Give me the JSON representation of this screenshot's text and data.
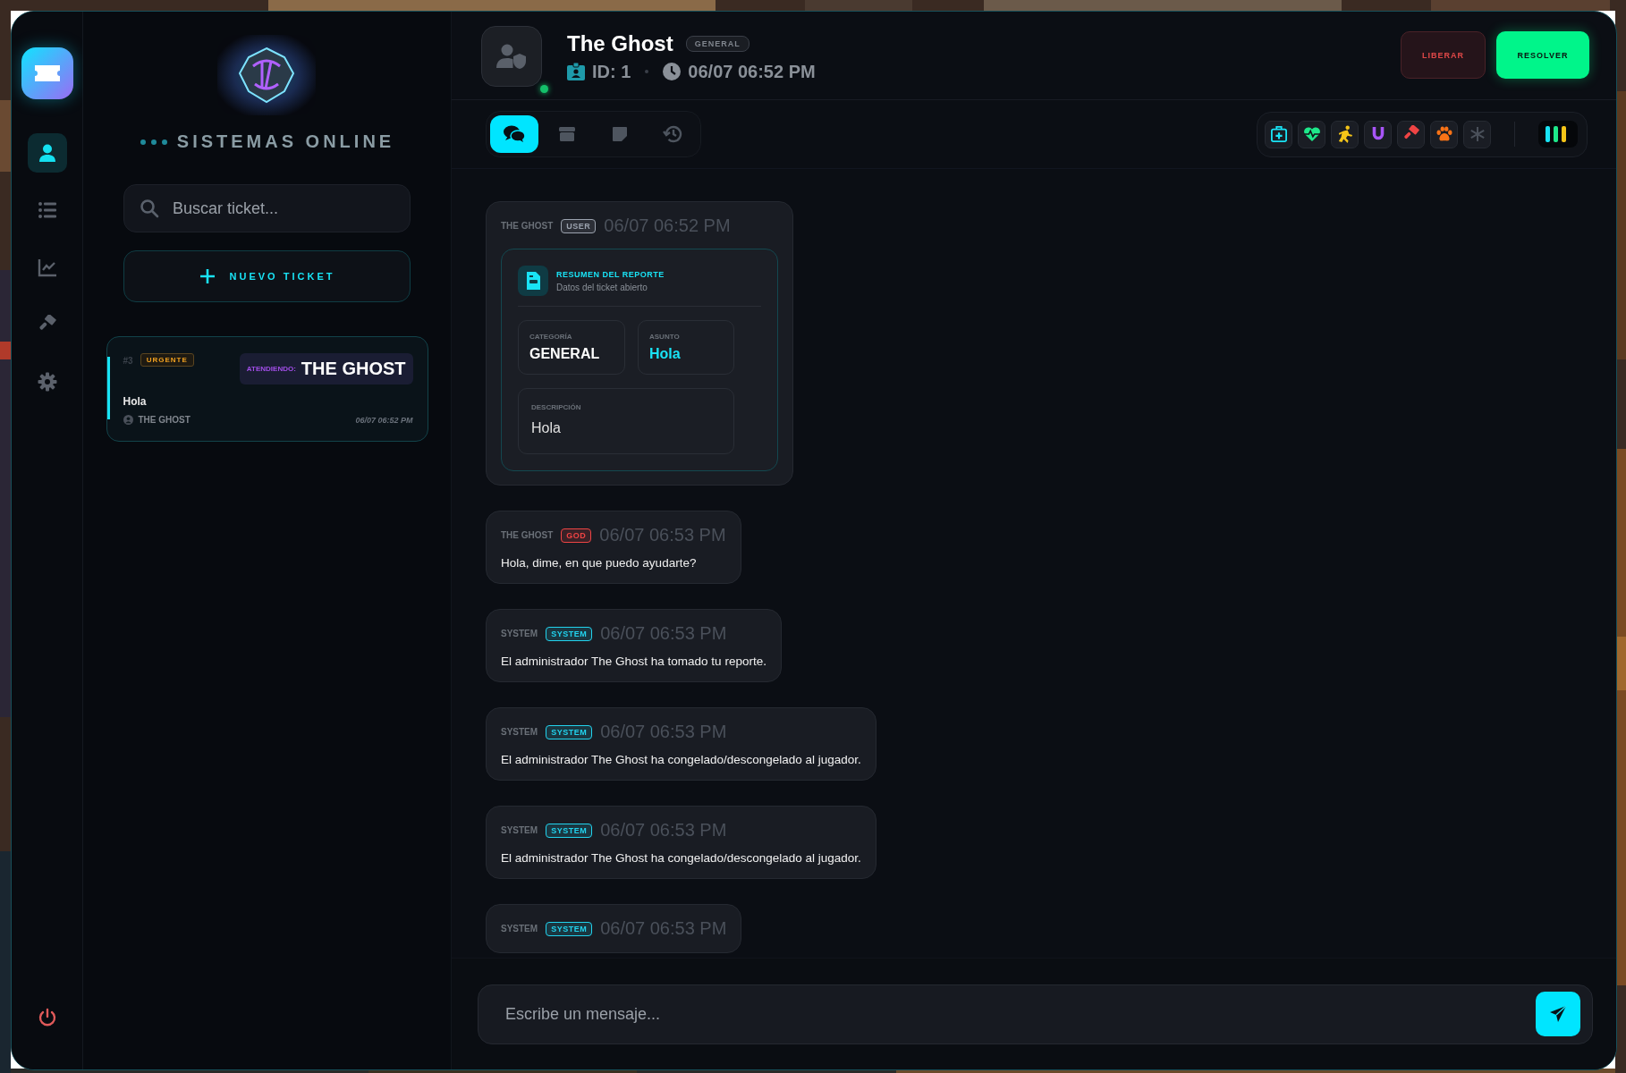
{
  "sidebar": {
    "nav": [
      {
        "selected": true
      },
      {
        "selected": false
      },
      {
        "selected": false
      },
      {
        "selected": false
      },
      {
        "selected": false
      }
    ]
  },
  "panel": {
    "status": "SISTEMAS ONLINE",
    "search": {
      "placeholder": "Buscar ticket..."
    },
    "new_ticket_button": "NUEVO TICKET",
    "tickets": [
      {
        "number": "#3",
        "priority": "URGENTE",
        "attending_label": "ATENDIENDO:",
        "attending_name": "THE GHOST",
        "subject": "Hola",
        "author": "THE GHOST",
        "time": "06/07 06:52 PM",
        "selected": true
      }
    ]
  },
  "header": {
    "name": "The Ghost",
    "category": "GENERAL",
    "id_label": "ID:",
    "id": "1",
    "time": "06/07 06:52 PM",
    "online": true,
    "buttons": [
      {
        "label": "LIBERAR",
        "kind": "danger"
      },
      {
        "label": "RESOLVER",
        "kind": "success"
      }
    ]
  },
  "tabs": [
    {
      "selected": true
    },
    {
      "selected": false
    },
    {
      "selected": false
    },
    {
      "selected": false
    }
  ],
  "messages": [
    {
      "kind": "summary",
      "author": "THE GHOST",
      "role": "USER",
      "color": "#9ca3af",
      "time": "06/07 06:52 PM",
      "summary": {
        "title": "RESUMEN DEL REPORTE",
        "subtitle": "Datos del ticket abierto",
        "fields": [
          {
            "label": "CATEGORÍA",
            "value": "GENERAL",
            "accent": false,
            "wide": false
          },
          {
            "label": "ASUNTO",
            "value": "Hola",
            "accent": true,
            "wide": false
          },
          {
            "label": "DESCRIPCIÓN",
            "value": "Hola",
            "accent": false,
            "wide": true
          }
        ]
      }
    },
    {
      "kind": "text",
      "author": "THE GHOST",
      "role": "GOD",
      "color": "#ef4444",
      "time": "06/07 06:53 PM",
      "text": "Hola, dime, en que puedo ayudarte?"
    },
    {
      "kind": "text",
      "author": "SYSTEM",
      "role": "SYSTEM",
      "color": "#22d3ee",
      "time": "06/07 06:53 PM",
      "text": "El administrador The Ghost ha tomado tu reporte."
    },
    {
      "kind": "text",
      "author": "SYSTEM",
      "role": "SYSTEM",
      "color": "#22d3ee",
      "time": "06/07 06:53 PM",
      "text": "El administrador The Ghost ha congelado/descongelado al jugador."
    },
    {
      "kind": "text",
      "author": "SYSTEM",
      "role": "SYSTEM",
      "color": "#22d3ee",
      "time": "06/07 06:53 PM",
      "text": "El administrador The Ghost ha congelado/descongelado al jugador."
    },
    {
      "kind": "text",
      "author": "SYSTEM",
      "role": "SYSTEM",
      "color": "#22d3ee",
      "time": "06/07 06:53 PM"
    }
  ],
  "composer": {
    "placeholder": "Escribe un mensaje..."
  }
}
